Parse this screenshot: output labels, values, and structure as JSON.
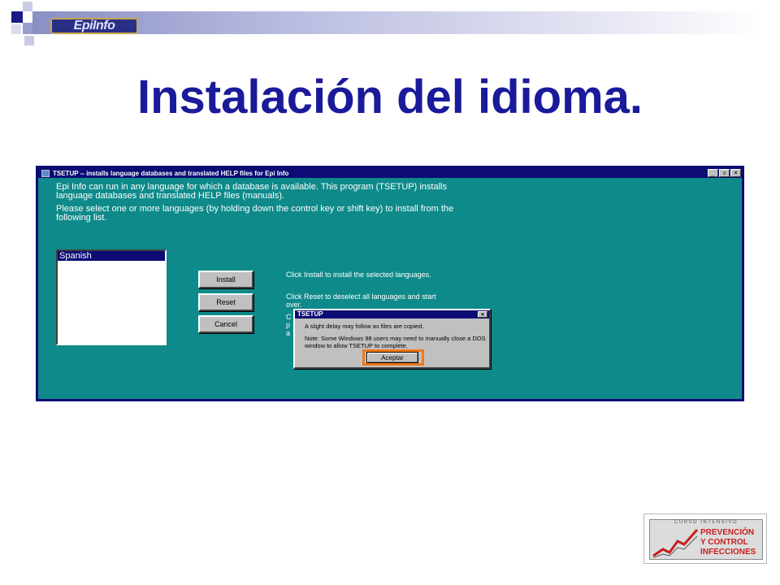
{
  "slide": {
    "title": "Instalación del idioma.",
    "logo_text": "EpiInfo"
  },
  "window": {
    "title": "TSETUP -- installs language databases and translated HELP files for Epi Info",
    "controls": [
      "_",
      "▫",
      "×"
    ],
    "intro_1": "Epi Info can run in any language for which a database is available.  This program (TSETUP) installs language databases and translated HELP files (manuals).",
    "intro_2": "Please select one or more languages (by holding down the control key or shift key) to install from the following list.",
    "languages": [
      "Spanish"
    ],
    "buttons": {
      "install": "Install",
      "reset": "Reset",
      "cancel": "Cancel"
    },
    "help": {
      "install": "Click Install to install the selected languages.",
      "reset": "Click Reset to deselect all languages and start over.",
      "cancel_partial": [
        "C",
        "p",
        "a"
      ]
    }
  },
  "dialog": {
    "title": "TSETUP",
    "close": "×",
    "message_1": "A slight delay may follow as files are copied.",
    "message_2": "Note:  Some Windows 98 users may need to manually close a DOS window to allow TSETUP to complete.",
    "ok_label": "Aceptar",
    "highlight_color": "#f07a1a"
  },
  "course_logo": {
    "top": "CURSO INTENSIVO",
    "line_1": "PREVENCIÓN",
    "line_2": "Y CONTROL",
    "line_3": "INFECCIONES"
  },
  "colors": {
    "title": "#1a1a9a",
    "window_bg": "#0e8a8a",
    "titlebar": "#0c0c74"
  }
}
